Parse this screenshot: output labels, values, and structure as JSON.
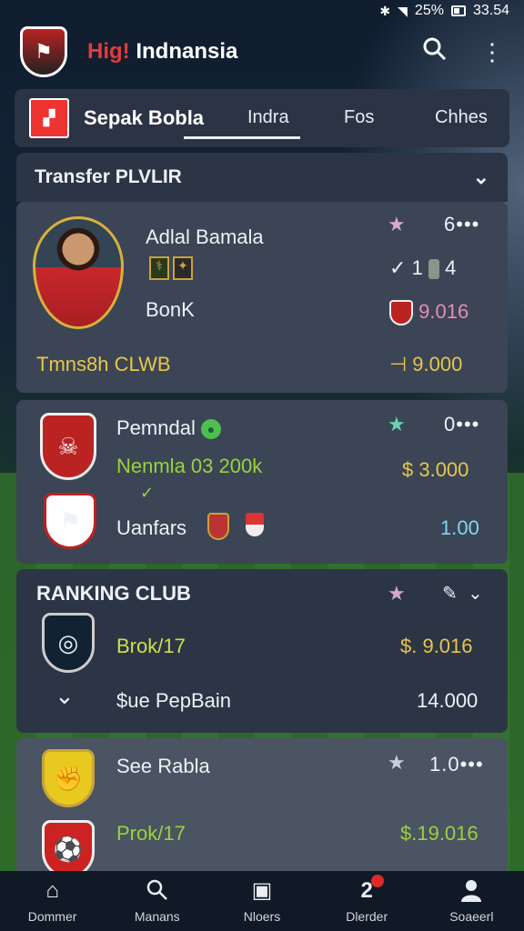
{
  "status_bar": {
    "battery": "25%",
    "time": "33.54"
  },
  "app_bar": {
    "title_red": "Hig!",
    "title_white": "Indnansia"
  },
  "tabs": {
    "brand": "Sepak Bobla",
    "items": [
      "Indra",
      "Fos",
      "Chhes"
    ],
    "active": "Indra"
  },
  "transfer_section": {
    "title": "Transfer PLVLIR"
  },
  "player_card": {
    "name": "Adlal Bamala",
    "club": "BonK",
    "rank": "6",
    "stats": "1",
    "stats_count": "4",
    "value": "9.016",
    "footer_label": "Tmns8h CLWB",
    "footer_amount": "9.000"
  },
  "club_card": {
    "name": "Pemndal",
    "detail": "Nenmla 03 200k",
    "count": "0",
    "amount": "$ 3.000",
    "sub_name": "Uanfars",
    "sub_amount": "1.00"
  },
  "ranking_section": {
    "title": "RANKING CLUB",
    "rows": [
      {
        "name": "Brok/17",
        "amount": "$. 9.016"
      },
      {
        "name": "$ue PepBain",
        "amount": "14.000"
      }
    ]
  },
  "bottom_card": {
    "name": "See Rabla",
    "score": "1.0",
    "row_name": "Prok/17",
    "row_amount": "$.19.016"
  },
  "nav": [
    {
      "label": "Dommer",
      "icon": "home-icon"
    },
    {
      "label": "Manans",
      "icon": "search-icon"
    },
    {
      "label": "Nloers",
      "icon": "square-icon"
    },
    {
      "label": "Dlerder",
      "icon": "notification-icon"
    },
    {
      "label": "Soaeerl",
      "icon": "profile-icon"
    }
  ],
  "colors": {
    "accent_red": "#e73a3a",
    "value_pink": "#e98bb5",
    "value_gold": "#e8c64a",
    "value_green": "#9bd23a",
    "value_cyan": "#7ed8f0",
    "card_bg": "#3b4555"
  }
}
